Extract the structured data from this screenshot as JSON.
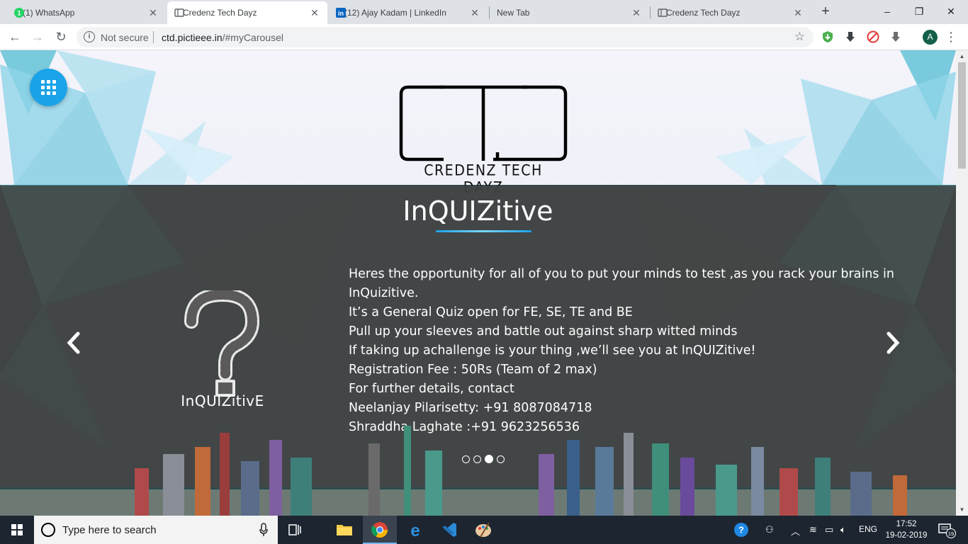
{
  "browser": {
    "tabs": [
      {
        "title": "(1) WhatsApp",
        "badge": "1",
        "active": false
      },
      {
        "title": "Credenz Tech Dayz",
        "active": true
      },
      {
        "title": "(12) Ajay Kadam | LinkedIn",
        "active": false
      },
      {
        "title": "New Tab",
        "active": false
      },
      {
        "title": "Credenz Tech Dayz",
        "active": false
      }
    ],
    "tab_close_glyph": "✕",
    "new_tab_glyph": "+",
    "window_controls": {
      "minimize": "–",
      "maximize": "❐",
      "close": "✕"
    },
    "nav": {
      "back": "←",
      "forward": "→",
      "reload": "↻"
    },
    "address": {
      "security_label": "Not secure",
      "host": "ctd.pictieee.in",
      "path": "/#myCarousel"
    },
    "star_glyph": "☆",
    "profile_initial": "A",
    "menu_glyph": "⋮"
  },
  "page": {
    "logo": {
      "title": "CTD",
      "subtitle": "CREDENZ TECH DAYZ"
    },
    "slide": {
      "title": "InQUIZitive",
      "image_label": "InQUIZitivE",
      "lines": [
        "Heres the opportunity for all of you to put your minds to test ,as you rack your brains in InQuizitive.",
        "It’s a General Quiz open for FE, SE, TE and BE",
        "Pull up your sleeves and battle out against sharp witted minds",
        "If taking up achallenge is your thing ,we’ll see you at InQUIZitive!",
        "Registration Fee : 50Rs (Team of 2 max)",
        "For further details, contact",
        "Neelanjay Pilarisetty: +91 8087084718",
        "Shraddha Laghate :+91 9623256536"
      ]
    },
    "carousel": {
      "total_slides": 4,
      "active_index": 2
    },
    "accent_color": "#1aa3e8"
  },
  "taskbar": {
    "search_placeholder": "Type here to search",
    "language": "ENG",
    "time": "17:52",
    "date": "19-02-2019",
    "notification_count": "19"
  }
}
